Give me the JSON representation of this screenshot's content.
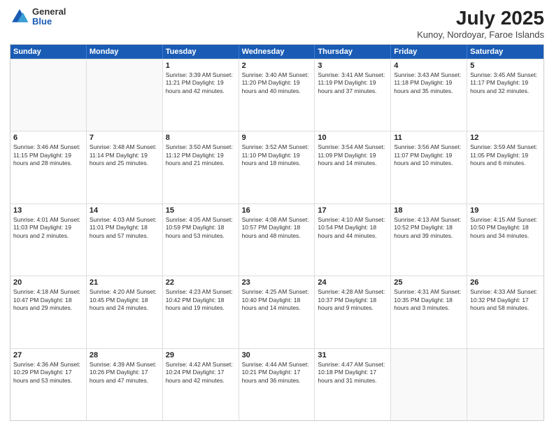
{
  "header": {
    "logo_general": "General",
    "logo_blue": "Blue",
    "title": "July 2025",
    "subtitle": "Kunoy, Nordoyar, Faroe Islands"
  },
  "days_of_week": [
    "Sunday",
    "Monday",
    "Tuesday",
    "Wednesday",
    "Thursday",
    "Friday",
    "Saturday"
  ],
  "weeks": [
    [
      {
        "day": "",
        "info": "",
        "empty": true
      },
      {
        "day": "",
        "info": "",
        "empty": true
      },
      {
        "day": "1",
        "info": "Sunrise: 3:39 AM\nSunset: 11:21 PM\nDaylight: 19 hours and 42 minutes."
      },
      {
        "day": "2",
        "info": "Sunrise: 3:40 AM\nSunset: 11:20 PM\nDaylight: 19 hours and 40 minutes."
      },
      {
        "day": "3",
        "info": "Sunrise: 3:41 AM\nSunset: 11:19 PM\nDaylight: 19 hours and 37 minutes."
      },
      {
        "day": "4",
        "info": "Sunrise: 3:43 AM\nSunset: 11:18 PM\nDaylight: 19 hours and 35 minutes."
      },
      {
        "day": "5",
        "info": "Sunrise: 3:45 AM\nSunset: 11:17 PM\nDaylight: 19 hours and 32 minutes."
      }
    ],
    [
      {
        "day": "6",
        "info": "Sunrise: 3:46 AM\nSunset: 11:15 PM\nDaylight: 19 hours and 28 minutes."
      },
      {
        "day": "7",
        "info": "Sunrise: 3:48 AM\nSunset: 11:14 PM\nDaylight: 19 hours and 25 minutes."
      },
      {
        "day": "8",
        "info": "Sunrise: 3:50 AM\nSunset: 11:12 PM\nDaylight: 19 hours and 21 minutes."
      },
      {
        "day": "9",
        "info": "Sunrise: 3:52 AM\nSunset: 11:10 PM\nDaylight: 19 hours and 18 minutes."
      },
      {
        "day": "10",
        "info": "Sunrise: 3:54 AM\nSunset: 11:09 PM\nDaylight: 19 hours and 14 minutes."
      },
      {
        "day": "11",
        "info": "Sunrise: 3:56 AM\nSunset: 11:07 PM\nDaylight: 19 hours and 10 minutes."
      },
      {
        "day": "12",
        "info": "Sunrise: 3:59 AM\nSunset: 11:05 PM\nDaylight: 19 hours and 6 minutes."
      }
    ],
    [
      {
        "day": "13",
        "info": "Sunrise: 4:01 AM\nSunset: 11:03 PM\nDaylight: 19 hours and 2 minutes."
      },
      {
        "day": "14",
        "info": "Sunrise: 4:03 AM\nSunset: 11:01 PM\nDaylight: 18 hours and 57 minutes."
      },
      {
        "day": "15",
        "info": "Sunrise: 4:05 AM\nSunset: 10:59 PM\nDaylight: 18 hours and 53 minutes."
      },
      {
        "day": "16",
        "info": "Sunrise: 4:08 AM\nSunset: 10:57 PM\nDaylight: 18 hours and 48 minutes."
      },
      {
        "day": "17",
        "info": "Sunrise: 4:10 AM\nSunset: 10:54 PM\nDaylight: 18 hours and 44 minutes."
      },
      {
        "day": "18",
        "info": "Sunrise: 4:13 AM\nSunset: 10:52 PM\nDaylight: 18 hours and 39 minutes."
      },
      {
        "day": "19",
        "info": "Sunrise: 4:15 AM\nSunset: 10:50 PM\nDaylight: 18 hours and 34 minutes."
      }
    ],
    [
      {
        "day": "20",
        "info": "Sunrise: 4:18 AM\nSunset: 10:47 PM\nDaylight: 18 hours and 29 minutes."
      },
      {
        "day": "21",
        "info": "Sunrise: 4:20 AM\nSunset: 10:45 PM\nDaylight: 18 hours and 24 minutes."
      },
      {
        "day": "22",
        "info": "Sunrise: 4:23 AM\nSunset: 10:42 PM\nDaylight: 18 hours and 19 minutes."
      },
      {
        "day": "23",
        "info": "Sunrise: 4:25 AM\nSunset: 10:40 PM\nDaylight: 18 hours and 14 minutes."
      },
      {
        "day": "24",
        "info": "Sunrise: 4:28 AM\nSunset: 10:37 PM\nDaylight: 18 hours and 9 minutes."
      },
      {
        "day": "25",
        "info": "Sunrise: 4:31 AM\nSunset: 10:35 PM\nDaylight: 18 hours and 3 minutes."
      },
      {
        "day": "26",
        "info": "Sunrise: 4:33 AM\nSunset: 10:32 PM\nDaylight: 17 hours and 58 minutes."
      }
    ],
    [
      {
        "day": "27",
        "info": "Sunrise: 4:36 AM\nSunset: 10:29 PM\nDaylight: 17 hours and 53 minutes."
      },
      {
        "day": "28",
        "info": "Sunrise: 4:39 AM\nSunset: 10:26 PM\nDaylight: 17 hours and 47 minutes."
      },
      {
        "day": "29",
        "info": "Sunrise: 4:42 AM\nSunset: 10:24 PM\nDaylight: 17 hours and 42 minutes."
      },
      {
        "day": "30",
        "info": "Sunrise: 4:44 AM\nSunset: 10:21 PM\nDaylight: 17 hours and 36 minutes."
      },
      {
        "day": "31",
        "info": "Sunrise: 4:47 AM\nSunset: 10:18 PM\nDaylight: 17 hours and 31 minutes."
      },
      {
        "day": "",
        "info": "",
        "empty": true
      },
      {
        "day": "",
        "info": "",
        "empty": true
      }
    ]
  ]
}
